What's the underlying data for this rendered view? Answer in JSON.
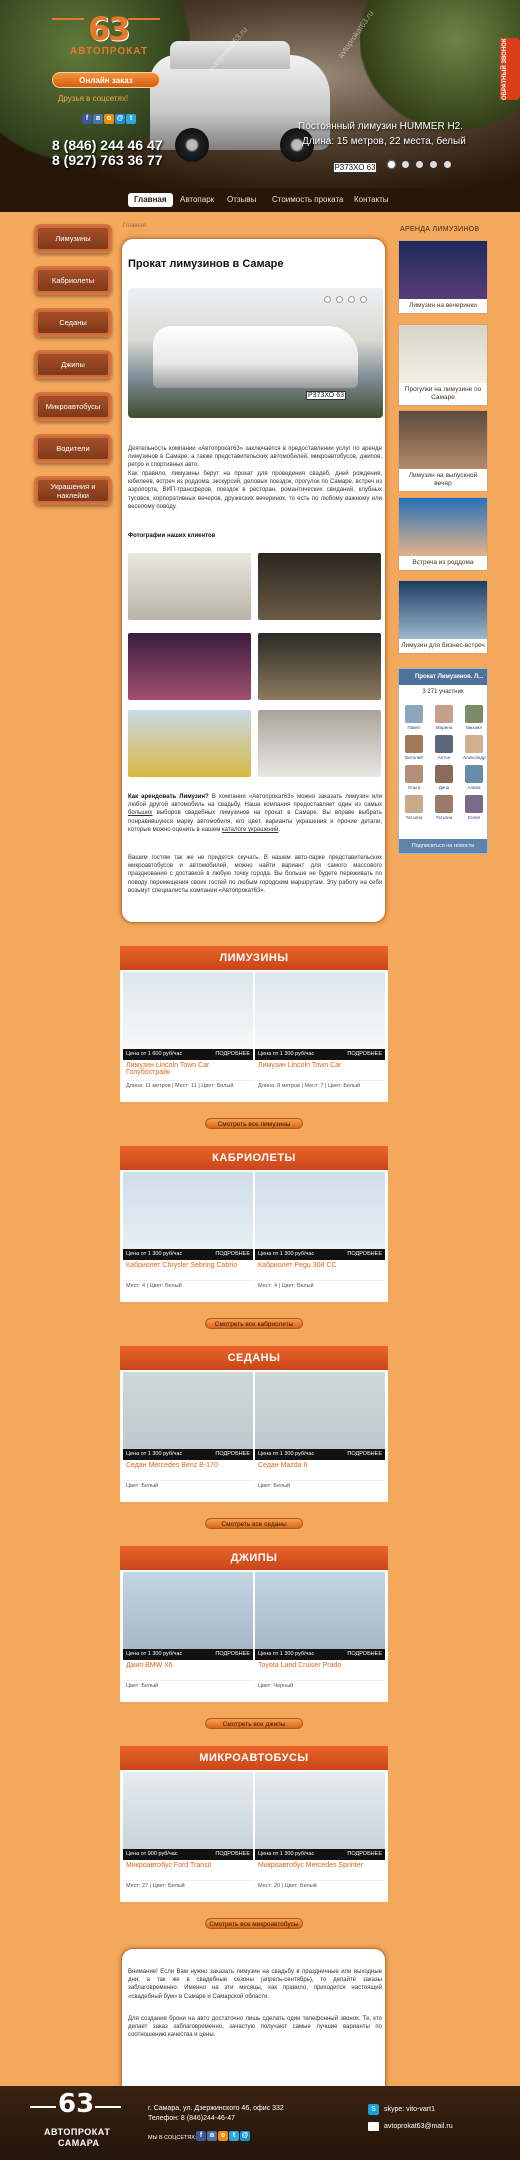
{
  "header": {
    "logo_number": "63",
    "logo_line1": "АВТОПРОКАТ",
    "order_button": "Онлайн заказ",
    "social_text": "Друзья в соцсетях!",
    "phone1": "8 (846) 244 46 47",
    "phone2": "8 (927) 763 36 77",
    "slide_title": "Постоянный лимузин HUMMER H2.",
    "slide_desc": "Длина: 15 метров, 22 места, белый",
    "slide_plate": "Р373ХО 63",
    "callback_tab": "ОБРАТНЫЙ ЗВОНОК",
    "watermark": "avtoprokat63.ru"
  },
  "nav": {
    "items": [
      "Главная",
      "Автопарк",
      "Отзывы",
      "Стоимость проката",
      "Контакты"
    ]
  },
  "left_menu": [
    "Лимузины",
    "Кабриолеты",
    "Седаны",
    "Джипы",
    "Микроавтобусы",
    "Водители",
    "Украшения и наклейки"
  ],
  "breadcrumb": "Главная",
  "content": {
    "title": "Прокат лимузинов в Самаре",
    "slider_plate": "Р373ХО 63",
    "p1": "Деятельность компании «Автопрокат63» заключается в предоставлении услуг по аренде лимузинов в Самаре, а также представительских автомобилей, микроавтобусов, джипов, ретро и спортивных авто.",
    "p2": "Как правило, лимузины берут на прокат для проведения свадеб, дней рождения, юбилеев, встреч из роддома, экскурсий, деловых поездок, прогулок по Самаре, встреч из аэропорта, ВИП-трансферов, поездок в ресторан, романтических свиданий, клубных тусовок, корпоративных вечеров, дружеских вечеринок, то есть по любому важному или веселому поводу.",
    "photos_title": "Фотографии наших клиентов",
    "p3_bold": "Как арендовать Лимузин?",
    "p3": " В компании «Автопрокат63» можно заказать лимузин или любой другой автомобиль на свадьбу. Наша компания предоставляет один из самых ",
    "p3_link": "больших",
    "p3_rest": " выборов свадебных лимузинов на прокат в Самаре. Вы вправе выбрать понравившуюся марку автомобиля, его цвет, варианты украшения и прочие детали, которые можно оценить в нашем ",
    "p3_link2": "каталоге украшений",
    "p3_end": ".",
    "p4": "Вашим гостям так же не придется скучать. В нашем авто-парке представительских микроавтобусов и автомобилей, можно найти вариант для самого массового празднования с доставкой в любую точку города. Вы больше не будете переживать по поводу перемещения своих гостей по любым городским маршрутам. Эту работу на себя возьмут специалисты компании «Автопрокат63»."
  },
  "sidebar": {
    "title": "АРЕНДА ЛИМУЗИНОВ",
    "cards": [
      "Лимузин на вечеринки",
      "Прогулки на лимузине по Самаре",
      "Лимузин на выпускной вечер",
      "Встреча из роддома",
      "Лимузин для бизнес-встреч"
    ],
    "vk_title": "Прокат Лимузинов. Л...",
    "vk_count": "3 271 участник",
    "vk_names": [
      "Павел",
      "Марина",
      "Михаил",
      "Виталий",
      "Антон",
      "Александр",
      "Ольга",
      "Дина",
      "Алина",
      "Татьяна",
      "Татьяна",
      "Юлия"
    ],
    "vk_subscribe": "Подписаться на новости"
  },
  "sections": [
    {
      "title": "ЛИМУЗИНЫ",
      "cards": [
        {
          "price": "Цена от 1 600 руб/час",
          "more": "ПОДРОБНЕЕ",
          "name": "Лимузин Lincoln Town Car Голубострайк",
          "meta": "Длина: 11 метров | Мест: 11 | Цвет: Белый"
        },
        {
          "price": "Цена от 1 300 руб/час",
          "more": "ПОДРОБНЕЕ",
          "name": "Лимузин Lincoln Town Car",
          "meta": "Длина: 8 метров | Мест: 7 | Цвет: Белый"
        }
      ],
      "button": "Смотреть все лимузины"
    },
    {
      "title": "КАБРИОЛЕТЫ",
      "cards": [
        {
          "price": "Цена от 1 300 руб/час",
          "more": "ПОДРОБНЕЕ",
          "name": "Кабриолет Chrysler Sebring Cabrio",
          "meta": "Мест: 4 | Цвет: Белый"
        },
        {
          "price": "Цена от 1 300 руб/час",
          "more": "ПОДРОБНЕЕ",
          "name": "Кабриолет Pegu 308 CC",
          "meta": "Мест: 4 | Цвет: Белый"
        }
      ],
      "button": "Смотреть все кабриолеты"
    },
    {
      "title": "СЕДАНЫ",
      "cards": [
        {
          "price": "Цена от 1 300 руб/час",
          "more": "ПОДРОБНЕЕ",
          "name": "Седан Mercedes Benz B-170",
          "meta": "Цвет: Белый"
        },
        {
          "price": "Цена от 1 300 руб/час",
          "more": "ПОДРОБНЕЕ",
          "name": "Седан Mazda 6",
          "meta": "Цвет: Белый"
        }
      ],
      "button": "Смотреть все седаны"
    },
    {
      "title": "ДЖИПЫ",
      "cards": [
        {
          "price": "Цена от 1 300 руб/час",
          "more": "ПОДРОБНЕЕ",
          "name": "Джип BMW X6",
          "meta": "Цвет: Белый"
        },
        {
          "price": "Цена от 1 300 руб/час",
          "more": "ПОДРОБНЕЕ",
          "name": "Toyota Land Cruiser Prado",
          "meta": "Цвет: Черный"
        }
      ],
      "button": "Смотреть все джипы"
    },
    {
      "title": "МИКРОАВТОБУСЫ",
      "cards": [
        {
          "price": "Цена от 900 руб/час",
          "more": "ПОДРОБНЕЕ",
          "name": "Микроавтобус Ford Transit",
          "meta": "Мест: 27 | Цвет: Белый"
        },
        {
          "price": "Цена от 1 300 руб/час",
          "more": "ПОДРОБНЕЕ",
          "name": "Микроавтобус Mercedes Sprinter",
          "meta": "Мест: 20 | Цвет: Белый"
        }
      ],
      "button": "Смотреть все микроавтобусы"
    }
  ],
  "bottom_text": {
    "p1": "Внимание! Если Вам нужно заказать лимузин на свадьбу в праздничные или выходные дни, а так же в свадебные сезоны (апрель-сентябрь), то делайте заказы заблаговременно. Именно на эти месяцы, как правило, приходится настоящий «свадебный бум» в Самаре и Самарской области.",
    "p2": "Для создания брони на авто достаточно лишь сделать один телефонный звонок. Те, кто делает заказ заблаговременно, зачастую получают самые лучшие варианты по соотношению качества и цены."
  },
  "footer": {
    "logo_number": "63",
    "logo_line1": "АВТОПРОКАТ",
    "logo_line2": "САМАРА",
    "address": "г. Самара, ул. Дзержинского 46, офис 332",
    "phone": "Телефон: 8 (846)244-46-47",
    "social": "МЫ В СОЦСЕТЯХ:",
    "skype": "skype: vito-vart1",
    "email": "avtoprokat63@mail.ru"
  },
  "colors": {
    "accent": "#e7782a",
    "section_head": "#d9531f",
    "background": "#f3a85c",
    "dark": "#281709"
  }
}
